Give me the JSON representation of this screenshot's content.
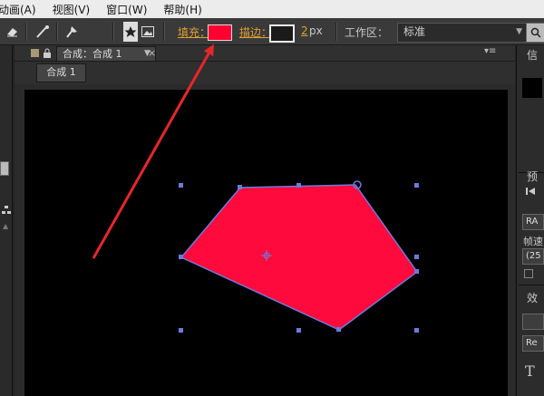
{
  "menubar": {
    "items": [
      "动画(A)",
      "视图(V)",
      "窗口(W)",
      "帮助(H)"
    ]
  },
  "toolbar": {
    "fill_label": "填充：",
    "stroke_label": "描边：",
    "stroke_width_value": "2",
    "stroke_width_unit": "px",
    "workspace_label": "工作区：",
    "workspace_value": "标准",
    "colors": {
      "fill": "#ff0030",
      "stroke": "#1a1a1a"
    }
  },
  "composition_panel": {
    "tab_label": "合成：合成 1",
    "subtab_label": "合成 1"
  },
  "right_dock": {
    "labels": [
      "信",
      "预",
      "效"
    ],
    "boxes": [
      "RA",
      "(25",
      "Re"
    ],
    "field_label": "帧速"
  },
  "canvas": {
    "shape_fill": "#ff0a3c",
    "selection_color": "#6a7bdc",
    "annotation_arrow_color": "#e8262a"
  }
}
